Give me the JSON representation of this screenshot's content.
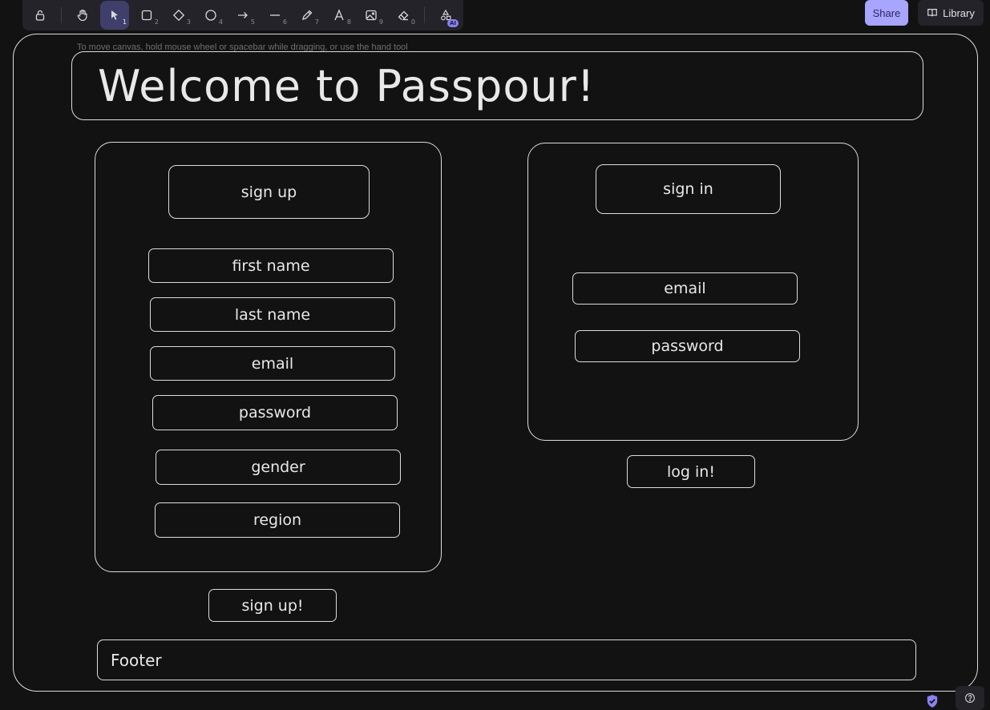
{
  "toolbar": {
    "tools": [
      {
        "name": "lock",
        "key": ""
      },
      {
        "name": "hand",
        "key": ""
      },
      {
        "name": "selection",
        "key": "1"
      },
      {
        "name": "rectangle",
        "key": "2"
      },
      {
        "name": "diamond",
        "key": "3"
      },
      {
        "name": "ellipse",
        "key": "4"
      },
      {
        "name": "arrow",
        "key": "5"
      },
      {
        "name": "line",
        "key": "6"
      },
      {
        "name": "draw",
        "key": "7"
      },
      {
        "name": "text",
        "key": "8"
      },
      {
        "name": "image",
        "key": "9"
      },
      {
        "name": "eraser",
        "key": "0"
      },
      {
        "name": "more-tools",
        "key": ""
      }
    ],
    "ai_badge": "AI",
    "selected_tool": "selection"
  },
  "header": {
    "share_label": "Share",
    "library_label": "Library"
  },
  "canvas": {
    "hint": "To move canvas, hold mouse wheel or spacebar while dragging, or use the hand tool",
    "title": "Welcome to Passpour!",
    "signup": {
      "heading": "sign up",
      "fields": [
        "first name",
        "last name",
        "email",
        "password",
        "gender",
        "region"
      ],
      "submit": "sign up!"
    },
    "signin": {
      "heading": "sign in",
      "fields": [
        "email",
        "password"
      ],
      "submit": "log in!"
    },
    "footer": "Footer"
  },
  "colors": {
    "background": "#121212",
    "stroke": "#dcdcdc",
    "accent": "#a8a5ff",
    "selected_tool_bg": "#403e6a"
  }
}
